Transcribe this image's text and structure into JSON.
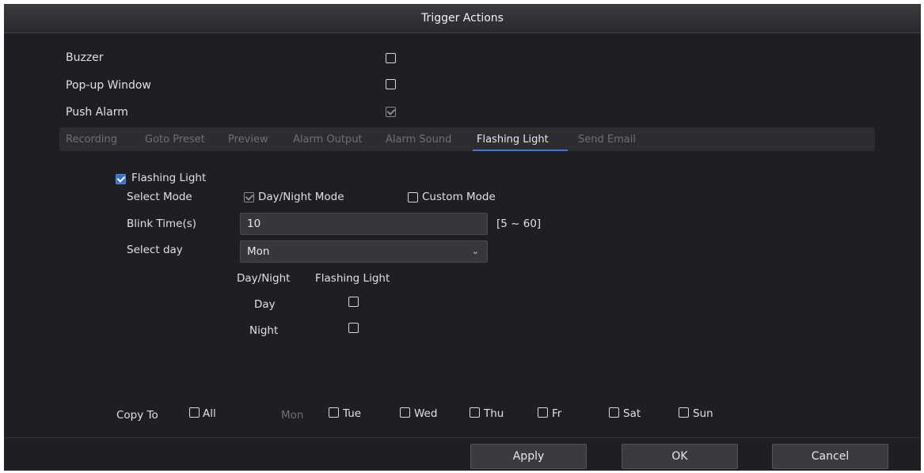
{
  "window": {
    "title": "Trigger Actions"
  },
  "options": [
    {
      "label": "Buzzer",
      "checked": false
    },
    {
      "label": "Pop-up Window",
      "checked": false
    },
    {
      "label": "Push Alarm",
      "checked": true
    }
  ],
  "tabs": [
    {
      "label": "Recording",
      "active": false
    },
    {
      "label": "Goto Preset",
      "active": false
    },
    {
      "label": "Preview",
      "active": false
    },
    {
      "label": "Alarm Output",
      "active": false
    },
    {
      "label": "Alarm Sound",
      "active": false
    },
    {
      "label": "Flashing Light",
      "active": true
    },
    {
      "label": "Send Email",
      "active": false
    }
  ],
  "flashing": {
    "enable_label": "Flashing Light",
    "enabled": true,
    "select_mode_label": "Select Mode",
    "mode_daynight": "Day/Night Mode",
    "mode_custom": "Custom Mode",
    "blink_time_label": "Blink Time(s)",
    "blink_time_value": "10",
    "blink_range": "[5 ~ 60]",
    "select_day_label": "Select day",
    "select_day_value": "Mon",
    "table_headers": [
      "Day/Night",
      "Flashing Light"
    ],
    "rows": [
      {
        "label": "Day",
        "checked": false
      },
      {
        "label": "Night",
        "checked": false
      }
    ]
  },
  "copy_to": {
    "label": "Copy To",
    "all": "All",
    "current_day": "Mon",
    "days": [
      "Tue",
      "Wed",
      "Thu",
      "Fr",
      "Sat",
      "Sun"
    ]
  },
  "buttons": {
    "apply": "Apply",
    "ok": "OK",
    "cancel": "Cancel"
  },
  "colors": {
    "accent": "#3c7ad8",
    "background": "#1f1f23",
    "text": "#e6e6e6"
  }
}
